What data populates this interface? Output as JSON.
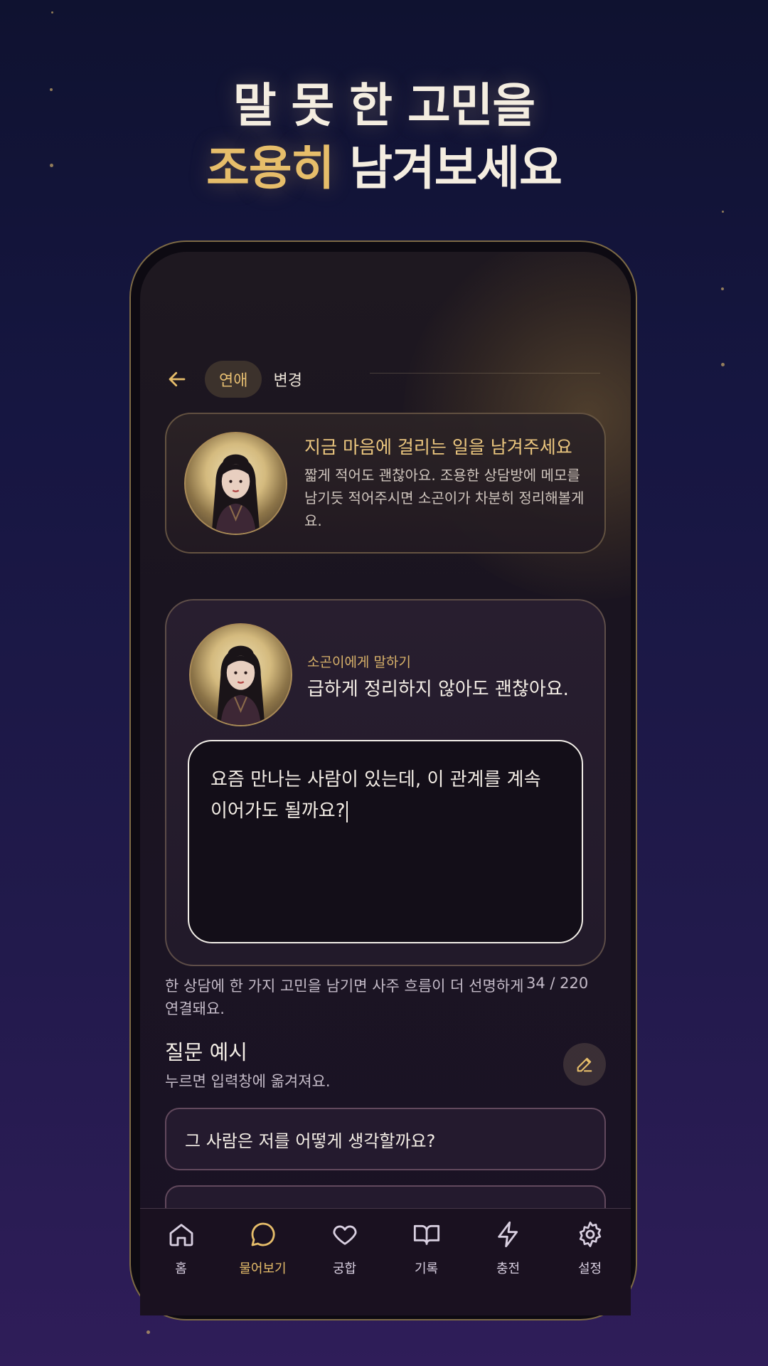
{
  "headline": {
    "line1": "말 못 한 고민을",
    "line2_accent": "조용히",
    "line2_rest": " 남겨보세요"
  },
  "colors": {
    "accent": "#e6bd6a",
    "background": "#161641",
    "card": "#241a2e"
  },
  "topbar": {
    "category_chip": "연애",
    "change_label": "변경"
  },
  "intro_card": {
    "title": "지금 마음에 걸리는 일을 남겨주세요",
    "body": "짧게 적어도 괜찮아요. 조용한 상담방에 메모를 남기듯 적어주시면 소곤이가 차분히 정리해볼게요."
  },
  "ask_card": {
    "label": "소곤이에게 말하기",
    "subtitle": "급하게 정리하지 않아도 괜찮아요.",
    "input_value": "요즘 만나는 사람이 있는데, 이 관계를 계속 이어가도 될까요?"
  },
  "hint": {
    "text": "한 상담에 한 가지 고민을 남기면 사주 흐름이 더 선명하게 연결돼요.",
    "counter": "34 / 220"
  },
  "examples": {
    "title": "질문 예시",
    "subtitle": "누르면 입력창에 옮겨져요.",
    "items": [
      "그 사람은 저를 어떻게 생각할까요?"
    ]
  },
  "tabs": [
    {
      "label": "홈",
      "icon": "home-icon"
    },
    {
      "label": "물어보기",
      "icon": "chat-bubble-icon"
    },
    {
      "label": "궁합",
      "icon": "heart-icon"
    },
    {
      "label": "기록",
      "icon": "book-icon"
    },
    {
      "label": "충전",
      "icon": "lightning-icon"
    },
    {
      "label": "설정",
      "icon": "gear-icon"
    }
  ]
}
